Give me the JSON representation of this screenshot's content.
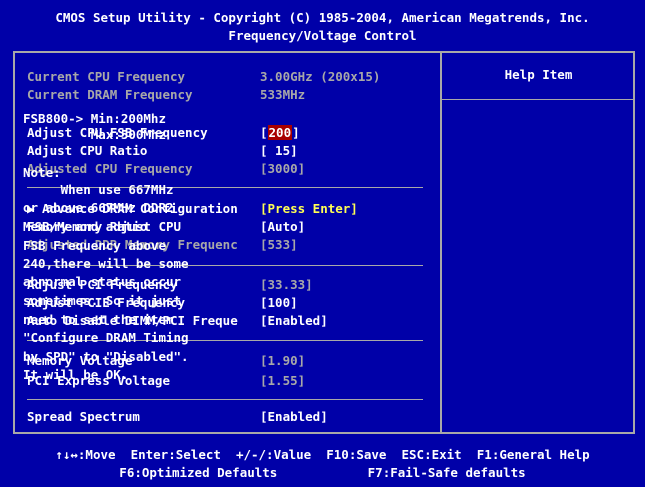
{
  "header": {
    "line1": "CMOS Setup Utility - Copyright (C) 1985-2004, American Megatrends, Inc.",
    "line2": "Frequency/Voltage Control"
  },
  "info": [
    {
      "label": "Current CPU Frequency",
      "value": "3.00GHz (200x15)"
    },
    {
      "label": "Current DRAM Frequency",
      "value": "533MHz"
    }
  ],
  "settings": {
    "cpu_fsb": {
      "label": "Adjust CPU FSB Frequency",
      "value_open": "[",
      "value_selected": "200",
      "value_close": "]"
    },
    "cpu_ratio": {
      "label": "Adjust CPU Ratio",
      "value": "[ 15]"
    },
    "adjusted_cpu_freq": {
      "label": "Adjusted CPU Frequency",
      "value": "[3000]"
    },
    "advance_dram": {
      "label": "▶ Advance DRAM Configuration",
      "value": "[Press Enter]"
    },
    "fsb_memory_ratio": {
      "label": "FSB/Memory Ratio",
      "value": "[Auto]"
    },
    "adjusted_ddr": {
      "label": "Adjusted DDR Memory Frequenc",
      "value": "[533]"
    },
    "pci_freq": {
      "label": "Adjust PCI Frequency",
      "value": "[33.33]"
    },
    "pcie_freq": {
      "label": "Adjust PCIE Frequency",
      "value": "[100]"
    },
    "auto_disable": {
      "label": "Auto Disable DIMM/PCI Freque",
      "value": "[Enabled]"
    },
    "memory_voltage": {
      "label": "Memory Voltage",
      "value": "[1.90]"
    },
    "pci_express_voltage": {
      "label": "PCI Express Voltage",
      "value": "[1.55]"
    },
    "spread_spectrum": {
      "label": "Spread Spectrum",
      "value": "[Enabled]"
    }
  },
  "help": {
    "title": "Help Item",
    "lines": [
      "FSB800-> Min:200Mhz",
      "         Max:500Mhz",
      "",
      "Note:",
      "     When use 667MHz",
      "or above 667MHz DDR2",
      "Memory and adjust CPU",
      "FSB Frequency above",
      "240,there will be some",
      "abnormal status occur",
      "sometimes. So it just",
      "need to set the item",
      "\"Configure DRAM Timing",
      "by SPD\" to \"Disabled\".",
      "It will be OK."
    ]
  },
  "footer": {
    "line1": "↑↓↔:Move  Enter:Select  +/-/:Value  F10:Save  ESC:Exit  F1:General Help",
    "line2": "F6:Optimized Defaults            F7:Fail-Safe defaults"
  },
  "colors": {
    "background": "#0000a8",
    "text": "#ffffff",
    "disabled": "#a8a8a8",
    "accent": "#ffff54",
    "selection": "#a80000"
  }
}
